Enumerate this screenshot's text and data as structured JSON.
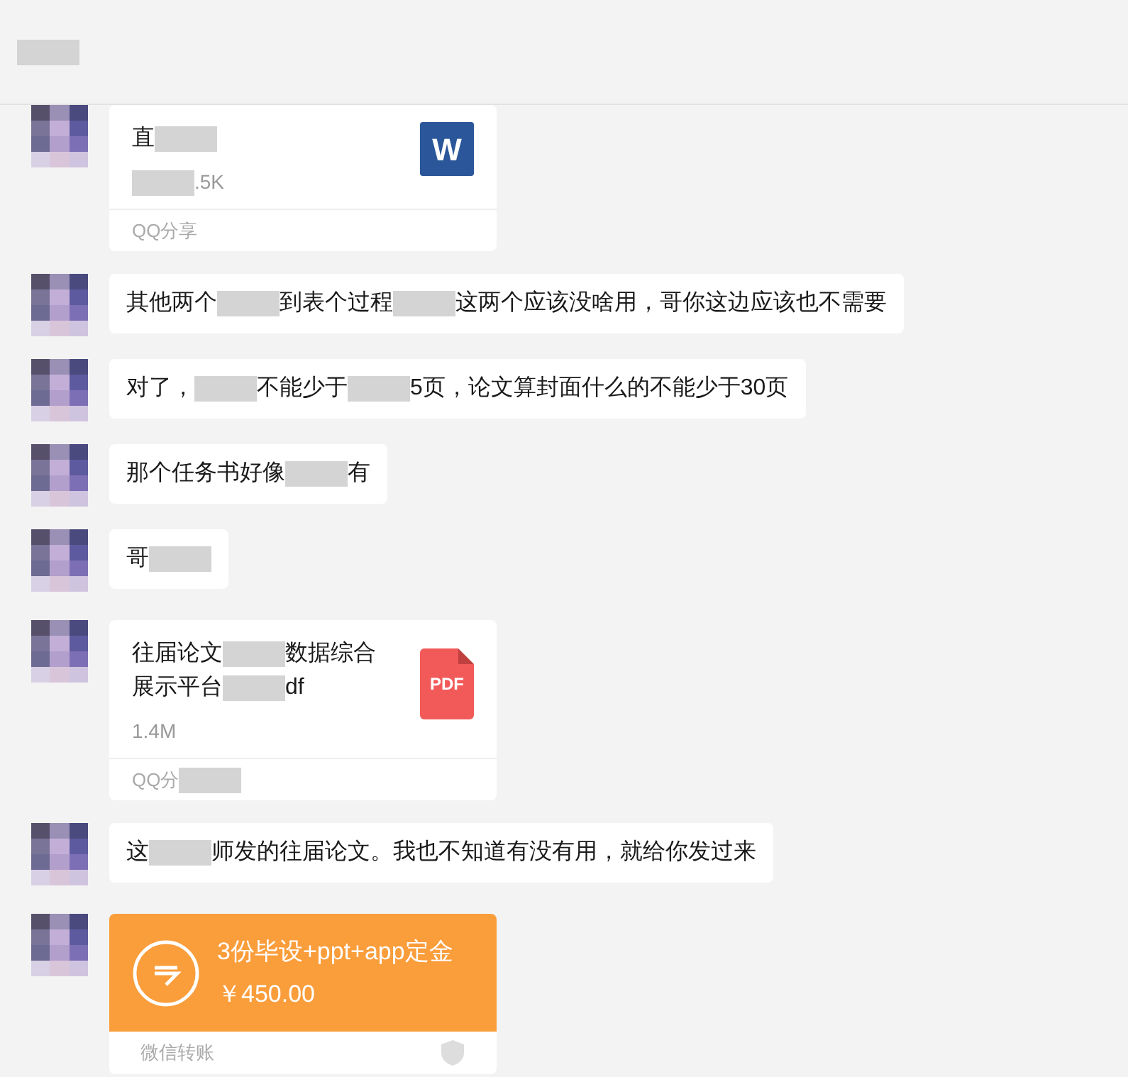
{
  "header": {
    "title": [
      {
        "kind": "mosaic"
      }
    ]
  },
  "messages": [
    {
      "kind": "file",
      "icon": {
        "kind": "word",
        "label": "W"
      },
      "name_lines": [
        [
          {
            "kind": "text",
            "text": "直"
          },
          {
            "kind": "mosaic"
          }
        ]
      ],
      "size": [
        {
          "kind": "mosaic"
        },
        {
          "kind": "text",
          "text": ".5K"
        }
      ],
      "footer": [
        {
          "kind": "text",
          "text": "QQ分享"
        }
      ]
    },
    {
      "kind": "text",
      "segments": [
        {
          "kind": "text",
          "text": "其他两个"
        },
        {
          "kind": "mosaic"
        },
        {
          "kind": "text",
          "text": "到表个过程"
        },
        {
          "kind": "mosaic"
        },
        {
          "kind": "text",
          "text": "这两个应该没啥用，哥你这边应该也不需要"
        }
      ]
    },
    {
      "kind": "text",
      "segments": [
        {
          "kind": "text",
          "text": "对了，"
        },
        {
          "kind": "mosaic"
        },
        {
          "kind": "text",
          "text": "不能少于"
        },
        {
          "kind": "mosaic"
        },
        {
          "kind": "text",
          "text": "5页，论文算封面什么的不能少于30页"
        }
      ]
    },
    {
      "kind": "text",
      "segments": [
        {
          "kind": "text",
          "text": "那个任务书好像"
        },
        {
          "kind": "mosaic"
        },
        {
          "kind": "text",
          "text": "有"
        }
      ]
    },
    {
      "kind": "text",
      "segments": [
        {
          "kind": "text",
          "text": "哥"
        },
        {
          "kind": "mosaic"
        }
      ]
    },
    {
      "kind": "file",
      "icon": {
        "kind": "pdf",
        "label": "PDF"
      },
      "name_lines": [
        [
          {
            "kind": "text",
            "text": "往届论文"
          },
          {
            "kind": "mosaic"
          },
          {
            "kind": "text",
            "text": "数据综合"
          }
        ],
        [
          {
            "kind": "text",
            "text": "展示平台"
          },
          {
            "kind": "mosaic"
          },
          {
            "kind": "text",
            "text": "df"
          }
        ]
      ],
      "size": [
        {
          "kind": "text",
          "text": "1.4M"
        }
      ],
      "footer": [
        {
          "kind": "text",
          "text": "QQ分"
        },
        {
          "kind": "mosaic"
        }
      ]
    },
    {
      "kind": "text",
      "segments": [
        {
          "kind": "text",
          "text": "这"
        },
        {
          "kind": "mosaic"
        },
        {
          "kind": "text",
          "text": "师发的往届论文。我也不知道有没有用，就给你发过来"
        }
      ]
    },
    {
      "kind": "transfer",
      "note": "3份毕设+ppt+app定金",
      "amount": "￥450.00",
      "footer": "微信转账"
    }
  ]
}
